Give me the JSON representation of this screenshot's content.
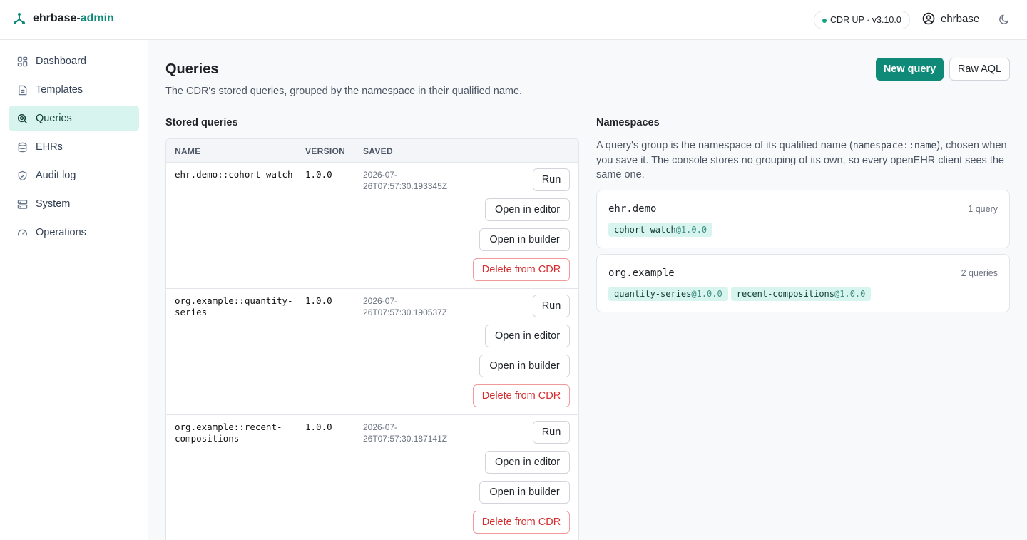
{
  "app": {
    "brand_prefix": "ehrbase-",
    "brand_suffix": "admin",
    "accent": "#0f8a78"
  },
  "header": {
    "status": "CDR UP · v3.10.0",
    "user": "ehrbase"
  },
  "sidebar": {
    "items": [
      {
        "label": "Dashboard",
        "icon": "dashboard-icon"
      },
      {
        "label": "Templates",
        "icon": "template-icon"
      },
      {
        "label": "Queries",
        "icon": "query-icon",
        "active": true
      },
      {
        "label": "EHRs",
        "icon": "database-icon"
      },
      {
        "label": "Audit log",
        "icon": "shield-icon"
      },
      {
        "label": "System",
        "icon": "server-icon"
      },
      {
        "label": "Operations",
        "icon": "gauge-icon"
      }
    ]
  },
  "page": {
    "title": "Queries",
    "subtitle": "The CDR's stored queries, grouped by the namespace in their qualified name.",
    "new_query": "New query",
    "raw_aql": "Raw AQL"
  },
  "stored": {
    "title": "Stored queries",
    "columns": [
      "NAME",
      "VERSION",
      "SAVED"
    ],
    "actions": {
      "run": "Run",
      "editor": "Open in editor",
      "builder": "Open in builder",
      "delete": "Delete from CDR"
    },
    "rows": [
      {
        "name_l1": "ehr.demo::cohort-watch",
        "name_l2": "",
        "version": "1.0.0",
        "saved_l1": "2026-07-",
        "saved_l2": "26T07:57:30.193345Z"
      },
      {
        "name_l1": "org.example::quantity-",
        "name_l2": "series",
        "version": "1.0.0",
        "saved_l1": "2026-07-",
        "saved_l2": "26T07:57:30.190537Z"
      },
      {
        "name_l1": "org.example::recent-",
        "name_l2": "compositions",
        "version": "1.0.0",
        "saved_l1": "2026-07-",
        "saved_l2": "26T07:57:30.187141Z"
      }
    ]
  },
  "namespaces": {
    "title": "Namespaces",
    "desc_before": "A query's group is the namespace of its qualified name (",
    "desc_code": "namespace::name",
    "desc_after": "), chosen when you save it. The console stores no grouping of its own, so every openEHR client sees the same one.",
    "groups": [
      {
        "name": "ehr.demo",
        "count": "1 query",
        "queries": [
          {
            "name": "cohort-watch",
            "version": "@1.0.0"
          }
        ]
      },
      {
        "name": "org.example",
        "count": "2 queries",
        "queries": [
          {
            "name": "quantity-series",
            "version": "@1.0.0"
          },
          {
            "name": "recent-compositions",
            "version": "@1.0.0"
          }
        ]
      }
    ]
  }
}
